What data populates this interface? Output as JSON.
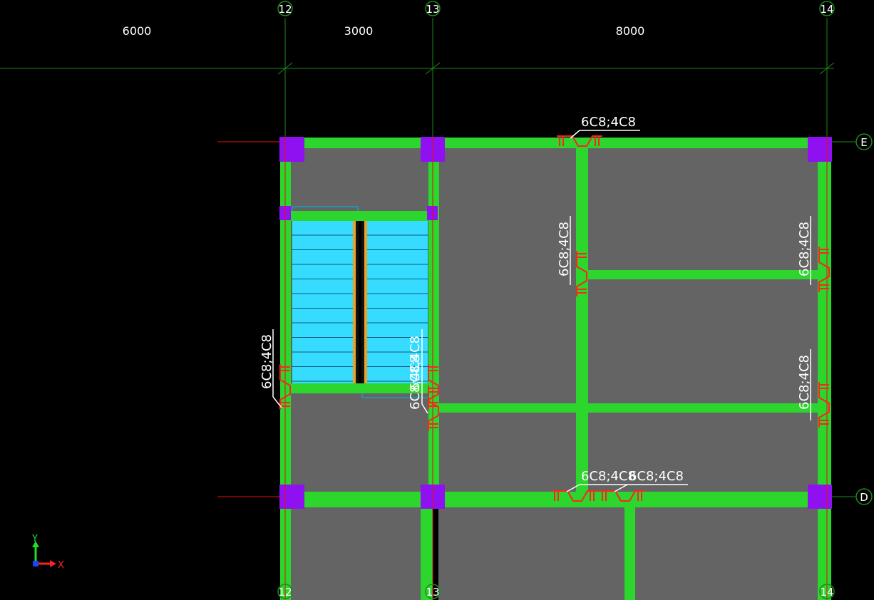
{
  "dimensions": [
    "6000",
    "3000",
    "8000"
  ],
  "axes_vertical": [
    "12",
    "13",
    "14"
  ],
  "axes_horizontal": [
    "E",
    "D"
  ],
  "rebar_label": "6C8;4C8",
  "ucs": {
    "y": "Y",
    "x": "X"
  },
  "colors": {
    "background": "#000000",
    "slab": "#646464",
    "beam": "#2cd62c",
    "column": "#8f10f0",
    "stair": "#35dcff",
    "stair_frame": "#f0a020",
    "rebar_mark": "#ff2222",
    "grid_line": "#1d8a1d",
    "axis_red": "#e01010"
  }
}
